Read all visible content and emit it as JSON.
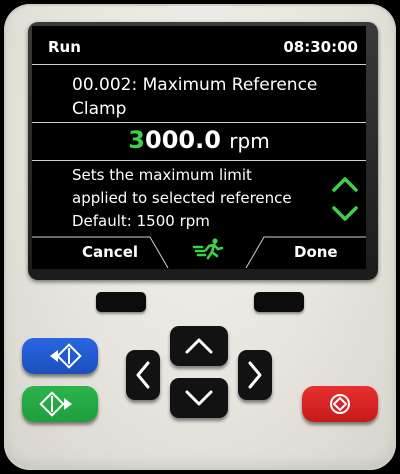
{
  "status": {
    "mode": "Run",
    "time": "08:30:00"
  },
  "parameter": {
    "title_line1": "00.002: Maximum Reference",
    "title_line2": "Clamp",
    "value_first_digit": "3",
    "value_rest": "000.0",
    "unit": "rpm"
  },
  "description": {
    "line1": "Sets the maximum limit",
    "line2": "applied to selected reference",
    "line3": "Default: 1500 rpm"
  },
  "softkeys": {
    "left": "Cancel",
    "right": "Done"
  },
  "colors": {
    "accent": "#3bd14a",
    "blue_button": "#1b4fbd",
    "green_button": "#1f9e3c",
    "red_button": "#d81f1f"
  },
  "icons": [
    "chevron-up-icon",
    "chevron-down-icon",
    "running-man-icon",
    "reverse-start-icon",
    "forward-start-icon",
    "stop-icon"
  ]
}
